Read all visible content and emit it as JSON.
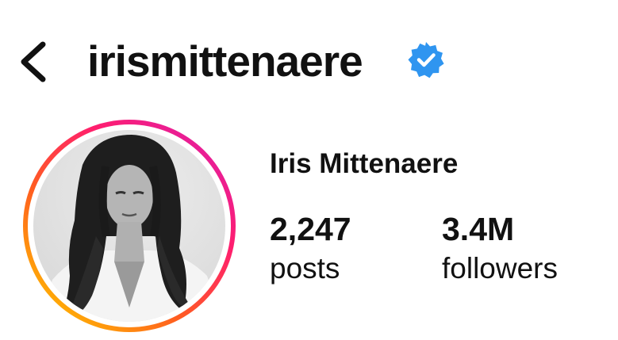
{
  "header": {
    "back_icon": "chevron-left-icon",
    "username": "irismittenaere",
    "verified_icon": "verified-badge-icon",
    "verified_color": "#2f95f0"
  },
  "profile": {
    "avatar_ring_colors": [
      "#ffbf00",
      "#ff5e1f",
      "#ff1e6e",
      "#e01ea5"
    ],
    "display_name": "Iris Mittenaere",
    "stats": {
      "posts_value": "2,247",
      "posts_label": "posts",
      "followers_value": "3.4M",
      "followers_label": "followers"
    }
  }
}
